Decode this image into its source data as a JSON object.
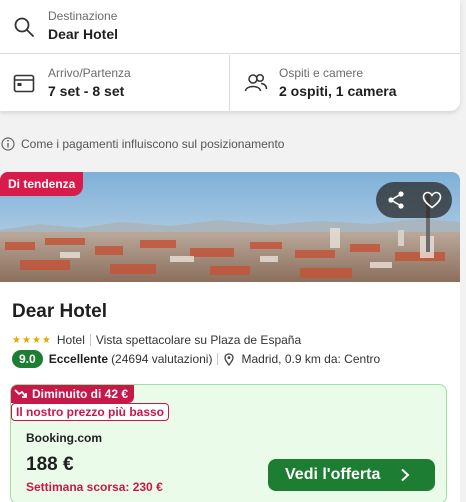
{
  "search": {
    "destination": {
      "label": "Destinazione",
      "value": "Dear Hotel",
      "icon": "search-icon"
    },
    "dates": {
      "label": "Arrivo/Partenza",
      "value": "7 set - 8 set",
      "icon": "calendar-icon"
    },
    "guests": {
      "label": "Ospiti e camere",
      "value": "2 ospiti, 1 camera",
      "icon": "people-icon"
    }
  },
  "info": {
    "text": "Come i pagamenti influiscono sul posizionamento",
    "icon": "info-icon"
  },
  "hotel": {
    "badge": "Di tendenza",
    "name": "Dear Hotel",
    "stars": 4,
    "type": "Hotel",
    "feature": "Vista spettacolare su Plaza de España",
    "rating": "9.0",
    "rating_word": "Eccellente",
    "reviews": "(24694 valutazioni)",
    "location": "Madrid, 0.9 km da: Centro"
  },
  "deal": {
    "drop_label": "Diminuito di 42 €",
    "low_price_label": "Il nostro prezzo più basso",
    "provider": "Booking.com",
    "price": "188 €",
    "last_week": "Settimana scorsa: 230 €",
    "button": "Vedi l'offerta"
  },
  "colors": {
    "accent_green": "#1d7d32",
    "badge_red": "#c7184a",
    "deal_bg": "#eafbe9"
  }
}
